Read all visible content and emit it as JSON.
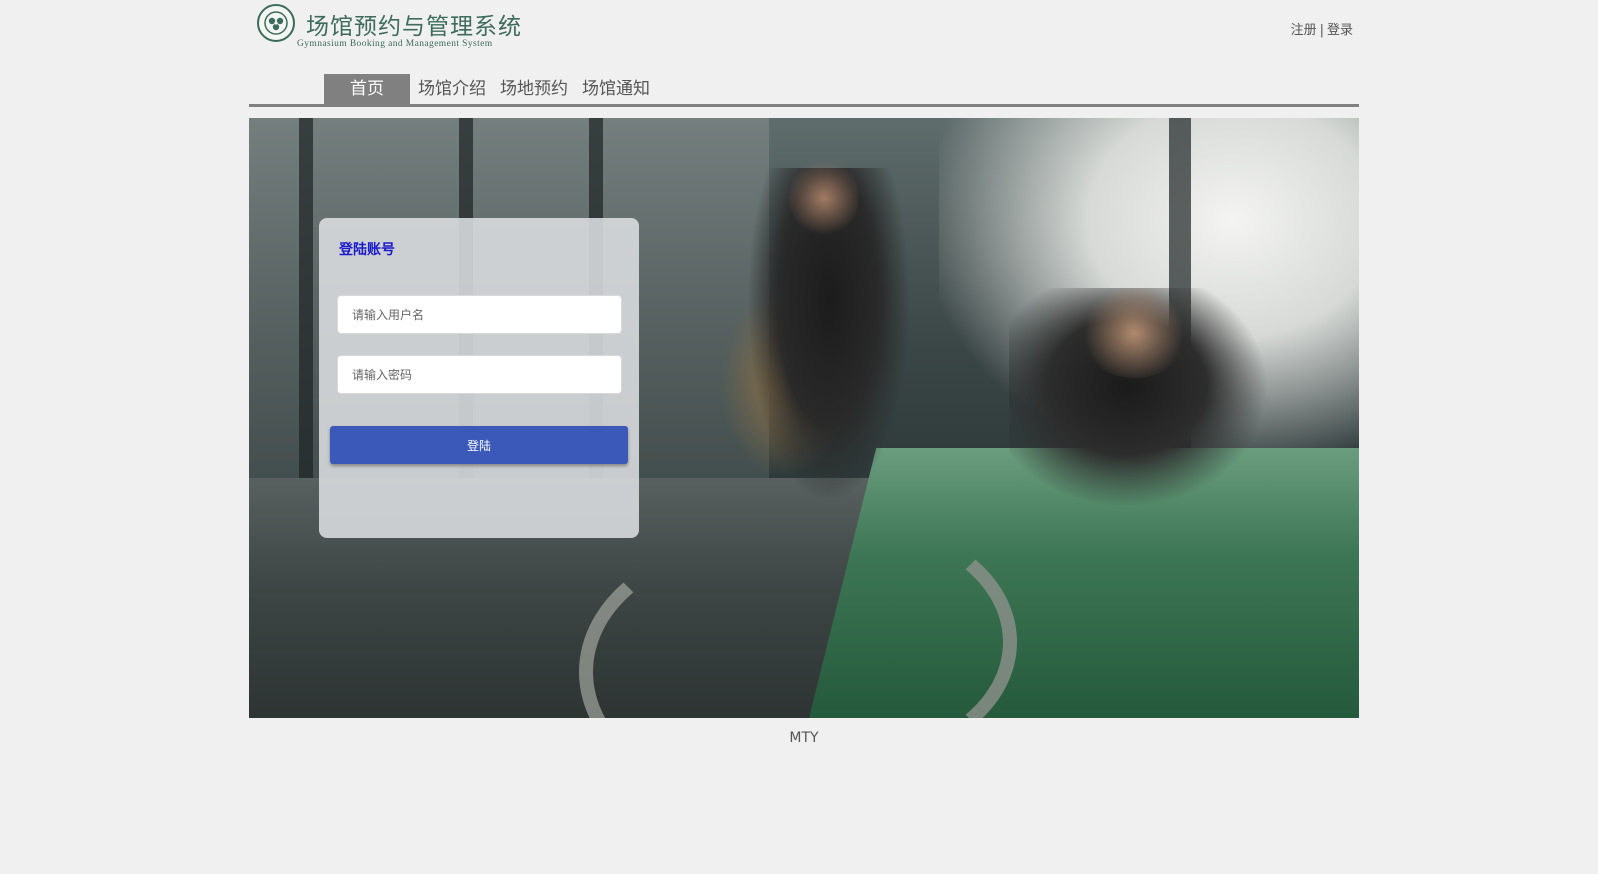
{
  "header": {
    "logo_title": "场馆预约与管理系统",
    "logo_subtitle": "Gymnasium Booking and Management System",
    "register_link": "注册",
    "separator": "|",
    "login_link": "登录"
  },
  "nav": {
    "items": [
      {
        "label": "首页",
        "active": true
      },
      {
        "label": "场馆介绍",
        "active": false
      },
      {
        "label": "场地预约",
        "active": false
      },
      {
        "label": "场馆通知",
        "active": false
      }
    ]
  },
  "login": {
    "title": "登陆账号",
    "username_placeholder": "请输入用户名",
    "password_placeholder": "请输入密码",
    "submit_label": "登陆"
  },
  "footer": {
    "text": "MTY"
  },
  "colors": {
    "brand": "#3d6b5c",
    "nav_active": "#808080",
    "login_title": "#1a1acc",
    "button": "#3a59b9"
  }
}
